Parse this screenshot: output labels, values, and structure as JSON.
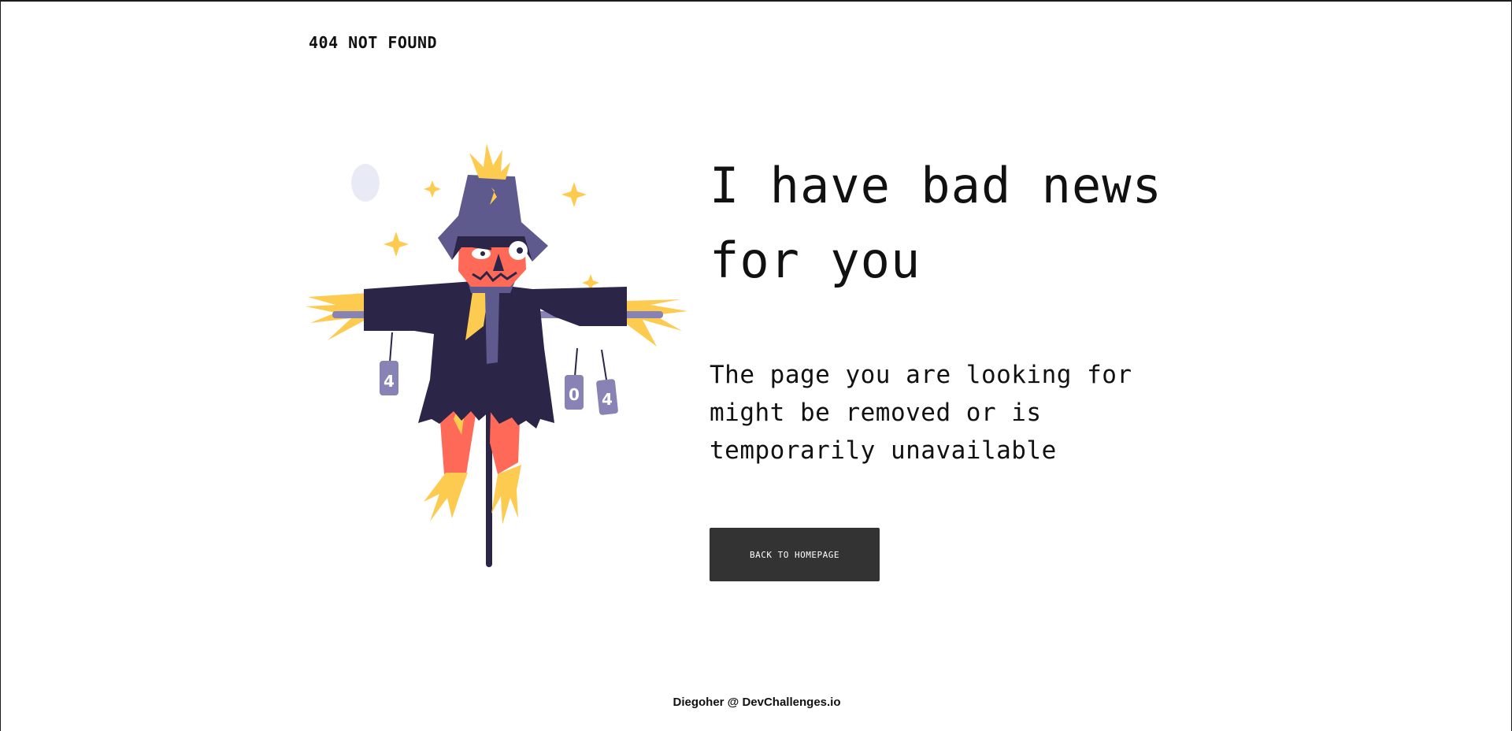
{
  "header": {
    "site_title": "404 NOT FOUND"
  },
  "illustration": {
    "description_icon": "scarecrow-illustration",
    "can_labels": [
      "4",
      "0",
      "4"
    ]
  },
  "main": {
    "headline": "I have bad news for you",
    "message": "The page you are looking for might be removed or is temporarily unavailable",
    "button_label": "BACK TO HOMEPAGE"
  },
  "footer": {
    "credit": "Diegoher @ DevChallenges.io"
  },
  "colors": {
    "button_bg": "#333333",
    "text": "#111111",
    "coat": "#2b2548",
    "hat": "#5f5a8e",
    "head": "#fe6a57",
    "straw": "#fdcb50",
    "can": "#8783b4"
  }
}
